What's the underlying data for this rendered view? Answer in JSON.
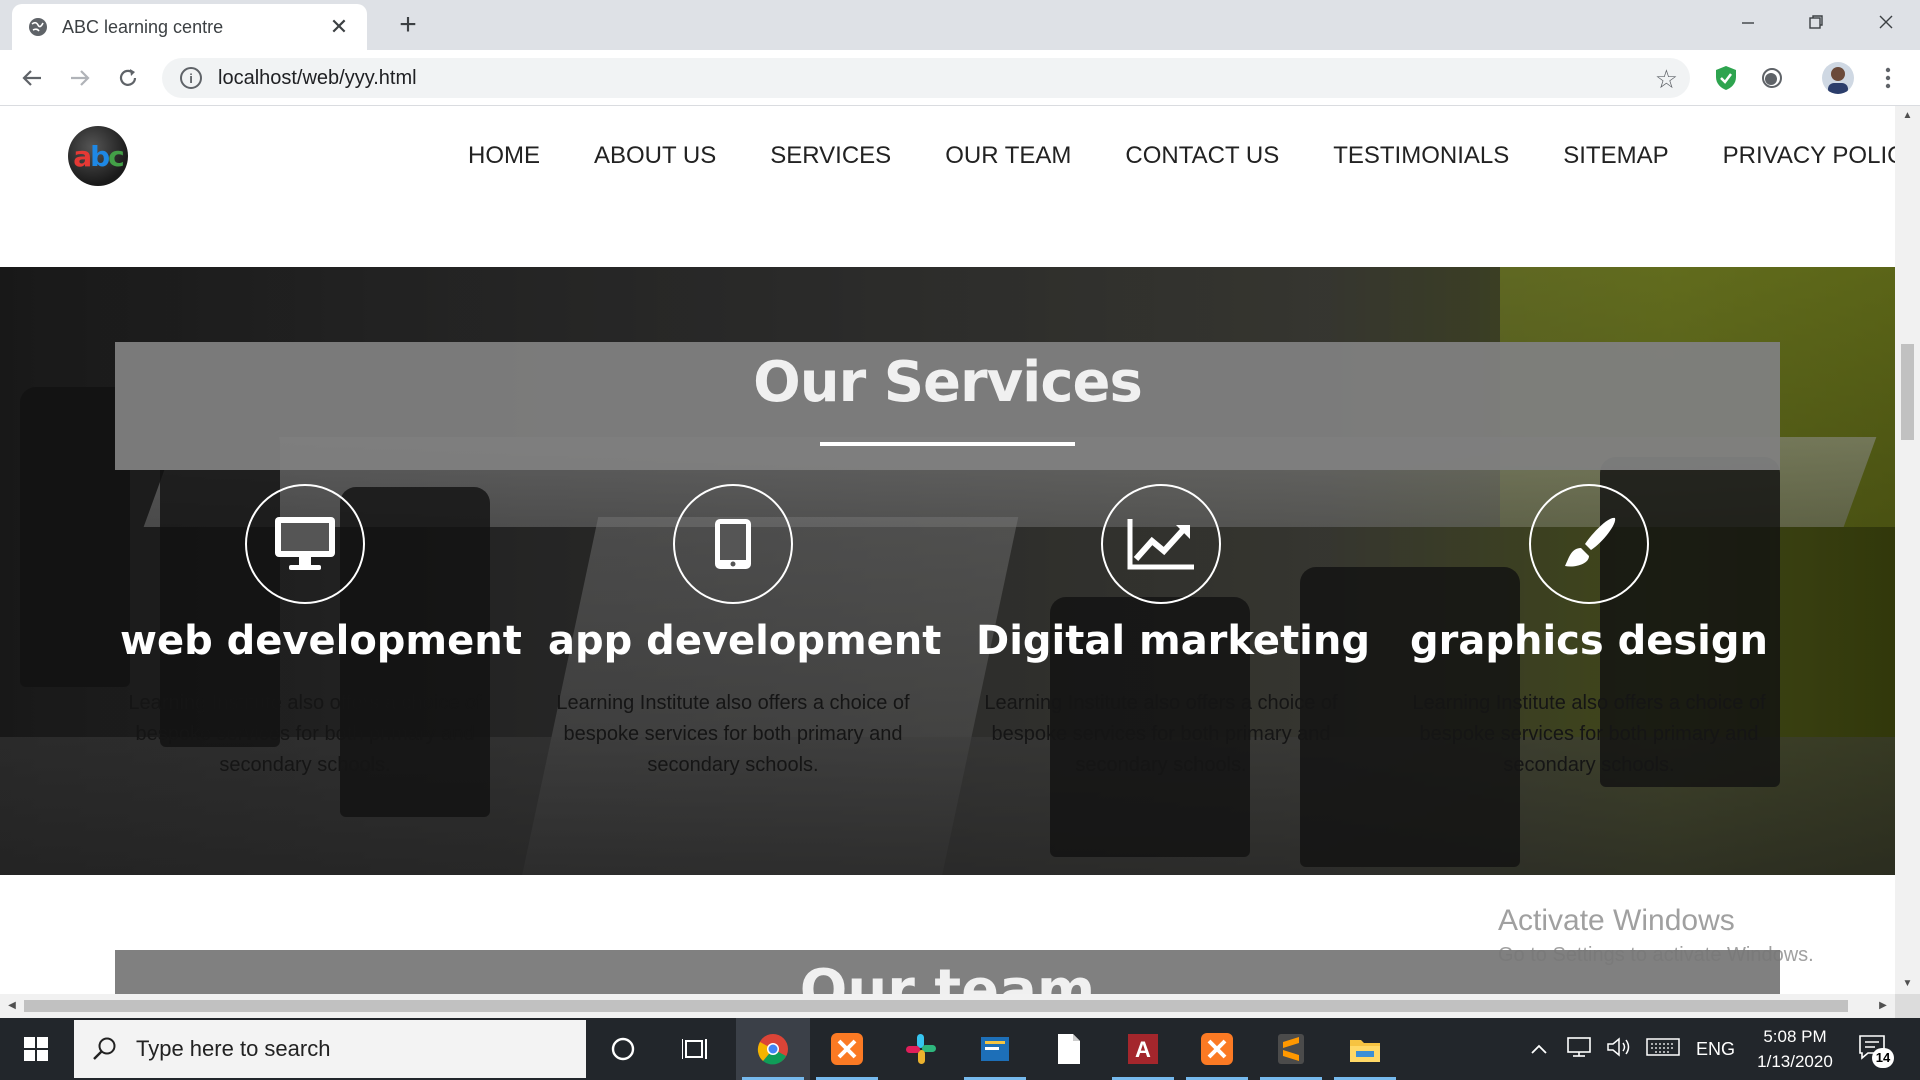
{
  "browser": {
    "tab_title": "ABC learning centre",
    "new_tab_label": "+",
    "tab_close_label": "✕",
    "url": "localhost/web/yyy.html"
  },
  "site": {
    "logo_text": [
      "a",
      "b",
      "c"
    ],
    "nav": [
      {
        "label": "HOME"
      },
      {
        "label": "ABOUT US"
      },
      {
        "label": "SERVICES"
      },
      {
        "label": "OUR TEAM"
      },
      {
        "label": "CONTACT US"
      },
      {
        "label": "TESTIMONIALS"
      },
      {
        "label": "SITEMAP"
      },
      {
        "label": "PRIVACY POLICY"
      }
    ],
    "services_title": "Our Services",
    "services": [
      {
        "icon": "desktop-icon",
        "title": "web development",
        "text": "Learning Institute also offers a choice of bespoke services for both primary and secondary schools."
      },
      {
        "icon": "tablet-icon",
        "title": "app development",
        "text": "Learning Institute also offers a choice of bespoke services for both primary and secondary schools."
      },
      {
        "icon": "line-chart-icon",
        "title": "Digital marketing",
        "text": "Learning Institute also offers a choice of bespoke services for both primary and secondary schools."
      },
      {
        "icon": "paint-brush-icon",
        "title": "graphics design",
        "text": "Learning Institute also offers a choice of bespoke services for both primary and secondary schools."
      }
    ],
    "team_title": "Our team"
  },
  "watermark": {
    "line1": "Activate Windows",
    "line2": "Go to Settings to activate Windows."
  },
  "taskbar": {
    "search_placeholder": "Type here to search",
    "language": "ENG",
    "time": "5:08 PM",
    "date": "1/13/2020",
    "notification_count": "14"
  },
  "colors": {
    "banner_gray": "#808080",
    "accent_blue": "#76b9ed",
    "taskbar_bg": "#22262b"
  }
}
